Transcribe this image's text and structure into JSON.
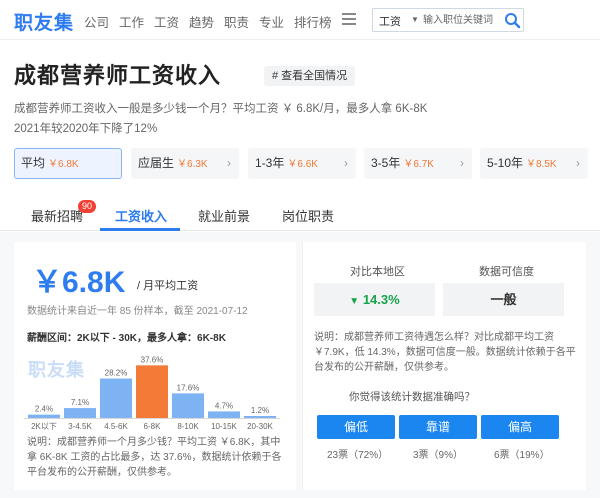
{
  "nav": {
    "logo": "职友集",
    "items": [
      "公司",
      "工作",
      "工资",
      "趋势",
      "职责",
      "专业",
      "排行榜"
    ],
    "search_category": "工资",
    "search_placeholder": "输入职位关键词"
  },
  "header": {
    "title": "成都营养师工资收入",
    "national_button": "# 查看全国情况",
    "summary_line1": "成都营养师工资收入一般是多少钱一个月？平均工资 ￥ 6.8K/月，最多人拿 6K-8K",
    "summary_line2": "2021年较2020年下降了12%"
  },
  "experience": [
    {
      "label": "平均",
      "value": "￥6.8K",
      "active": true
    },
    {
      "label": "应届生",
      "value": "￥6.3K",
      "active": false
    },
    {
      "label": "1-3年",
      "value": "￥6.6K",
      "active": false
    },
    {
      "label": "3-5年",
      "value": "￥6.7K",
      "active": false
    },
    {
      "label": "5-10年",
      "value": "￥8.5K",
      "active": false
    }
  ],
  "tabs": [
    {
      "label": "最新招聘",
      "badge": "90"
    },
    {
      "label": "工资收入",
      "active": true
    },
    {
      "label": "就业前景"
    },
    {
      "label": "岗位职责"
    }
  ],
  "salary": {
    "amount": "￥6.8K",
    "unit": "/ 月平均工资",
    "stat_note": "数据统计来自近一年 85 份样本，截至 2021-07-12",
    "range_label": "薪酬区间：",
    "range_value": "2K以下 - 30K，最多人拿：",
    "range_most": "6K-8K",
    "watermark": "职友集",
    "description": "说明：成都营养师一个月多少钱？平均工资 ￥6.8K，其中拿 6K-8K 工资的占比最多，达 37.6%，数据统计依赖于各平台发布的公开薪酬，仅供参考。"
  },
  "chart_data": {
    "type": "bar",
    "categories": [
      "2K以下",
      "3-4.5K",
      "4.5-6K",
      "6-8K",
      "8-10K",
      "10-15K",
      "20-30K"
    ],
    "values": [
      2.4,
      7.1,
      28.2,
      37.6,
      17.6,
      4.7,
      1.2
    ],
    "value_labels": [
      "2.4%",
      "7.1%",
      "28.2%",
      "37.6%",
      "17.6%",
      "4.7%",
      "1.2%"
    ],
    "highlight_index": 3,
    "colors": {
      "normal": "#7db3f3",
      "highlight": "#f47a37"
    },
    "ylim": [
      0,
      40
    ]
  },
  "comparison": {
    "local_label": "对比本地区",
    "local_value": "14.3%",
    "local_arrow": "▼",
    "reliability_label": "数据可信度",
    "reliability_value": "一般",
    "description": "说明：成都营养师工资待遇怎么样？对比成都平均工资 ￥7.9K，低 14.3%，数据可信度一般。数据统计依赖于各平台发布的公开薪酬，仅供参考。",
    "question": "你觉得该统计数据准确吗？",
    "votes": [
      {
        "label": "偏低",
        "count": "23票（72%）"
      },
      {
        "label": "靠谱",
        "count": "3票（9%）"
      },
      {
        "label": "偏高",
        "count": "6票（19%）"
      }
    ]
  },
  "colors": {
    "brand": "#2d7cf0",
    "accent": "#f07a36",
    "good": "#17a34a",
    "vote": "#1b86f0"
  }
}
